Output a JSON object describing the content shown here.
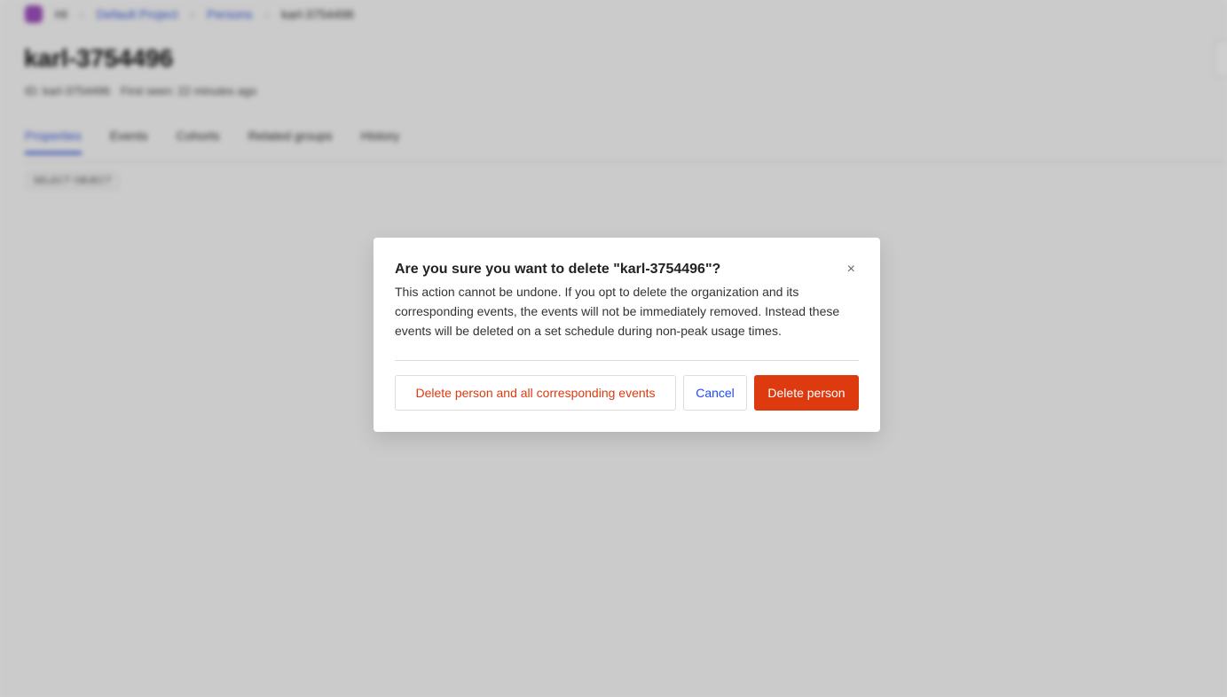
{
  "background": {
    "breadcrumb": {
      "org": "HI",
      "project": "Default Project",
      "section": "Persons",
      "current": "karl-3754496"
    },
    "page_title": "karl-3754496",
    "meta": {
      "id": "ID: karl-3754496",
      "first_seen": "First seen: 22 minutes ago"
    },
    "tabs": [
      "Properties",
      "Events",
      "Cohorts",
      "Related groups",
      "History"
    ],
    "chip": "SELECT OBJECT"
  },
  "modal": {
    "title": "Are you sure you want to delete \"karl-3754496\"?",
    "body": "This action cannot be undone. If you opt to delete the organization and its corresponding events, the events will not be immediately removed. Instead these events will be deleted on a set schedule during non-peak usage times.",
    "close_icon": "×",
    "delete_all_label": "Delete person and all corresponding events",
    "cancel_label": "Cancel",
    "delete_label": "Delete person"
  },
  "colors": {
    "danger": "#dd3a0f",
    "primary": "#1d4aff"
  }
}
